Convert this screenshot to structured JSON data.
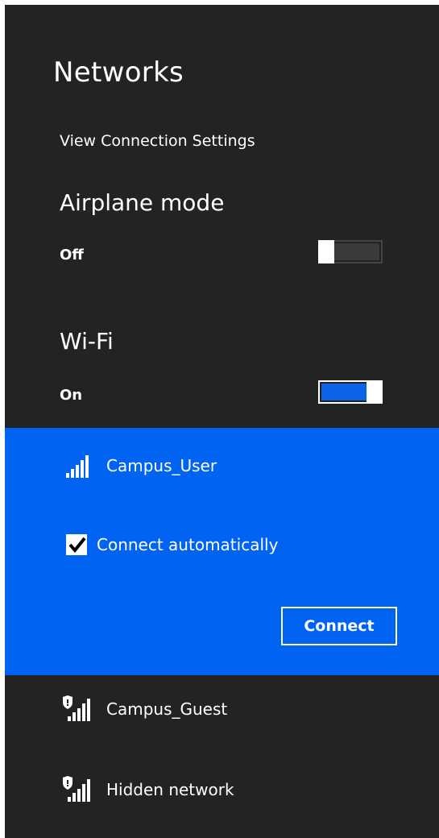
{
  "header": {
    "title": "Networks",
    "settings_link": "View Connection Settings"
  },
  "airplane": {
    "title": "Airplane mode",
    "state": "Off"
  },
  "wifi": {
    "title": "Wi-Fi",
    "state": "On"
  },
  "selected_network": {
    "name": "Campus_User",
    "icon": "signal-bars-icon",
    "connect_auto_label": "Connect automatically",
    "connect_auto_checked": true,
    "connect_label": "Connect"
  },
  "networks": [
    {
      "name": "Campus_Guest",
      "icon": "secured-signal-icon"
    },
    {
      "name": "Hidden network",
      "icon": "secured-signal-icon"
    }
  ],
  "colors": {
    "panel": "#232323",
    "accent": "#0063f2",
    "toggle_fill": "#0b63e5"
  }
}
